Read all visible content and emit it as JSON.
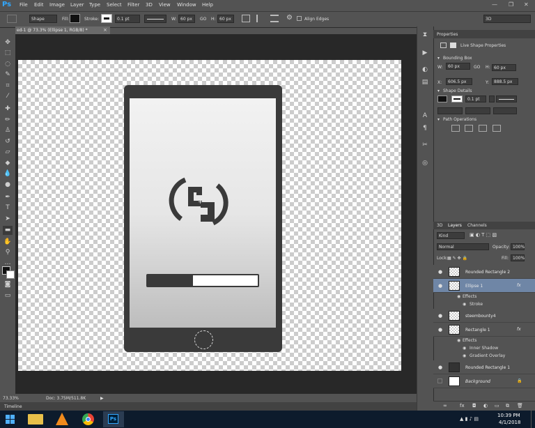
{
  "menu": {
    "logo": "Ps",
    "items": [
      "File",
      "Edit",
      "Image",
      "Layer",
      "Type",
      "Select",
      "Filter",
      "3D",
      "View",
      "Window",
      "Help"
    ],
    "controls": [
      "—",
      "❐",
      "✕"
    ]
  },
  "options": {
    "mode": "Shape",
    "fill_label": "Fill:",
    "stroke_label": "Stroke:",
    "stroke_width": "0.1 pt",
    "w_label": "W:",
    "w_value": "60 px",
    "link": "GO",
    "h_label": "H:",
    "h_value": "60 px",
    "align_edges": "Align Edges",
    "workspace": "3D"
  },
  "document": {
    "tab": "ed-1 @ 73.3% (Ellipse 1, RGB/8) *",
    "tab_close": "×"
  },
  "canvas_art": {
    "progress_fraction": 0.41
  },
  "status": {
    "zoom": "73.33%",
    "doc": "Doc: 3.75M/511.8K",
    "arrow": "▶",
    "timeline": "Timeline"
  },
  "properties": {
    "tab": "Properties",
    "title": "Live Shape Properties",
    "bounding_box": "Bounding Box",
    "w_label": "W:",
    "w_value": "60 px",
    "h_label": "H:",
    "h_value": "60 px",
    "go": "GO",
    "x_label": "X:",
    "x_value": "606.5 px",
    "y_label": "Y:",
    "y_value": "888.5 px",
    "shape_details": "Shape Details",
    "stroke_width": "0.1 pt",
    "path_operations": "Path Operations"
  },
  "layers": {
    "tabs": [
      "3D",
      "Layers",
      "Channels"
    ],
    "kind": "Kind",
    "blend": "Normal",
    "opacity_label": "Opacity:",
    "opacity": "100%",
    "lock_label": "Lock:",
    "fill_label": "Fill:",
    "fill": "100%",
    "fx": "fx",
    "rows": [
      {
        "name": "Rounded Rectangle 2"
      },
      {
        "name": "Ellipse 1"
      },
      {
        "name": "steembounty4"
      },
      {
        "name": "Rectangle 1"
      },
      {
        "name": "Rounded Rectangle 1"
      },
      {
        "name": "Background"
      }
    ],
    "effects_label": "Effects",
    "effect_stroke": "Stroke",
    "effect_inner_shadow": "Inner Shadow",
    "effect_gradient": "Gradient Overlay"
  },
  "taskbar": {
    "time": "10:39 PM",
    "date": "4/1/2018",
    "ps_label": "Ps"
  }
}
